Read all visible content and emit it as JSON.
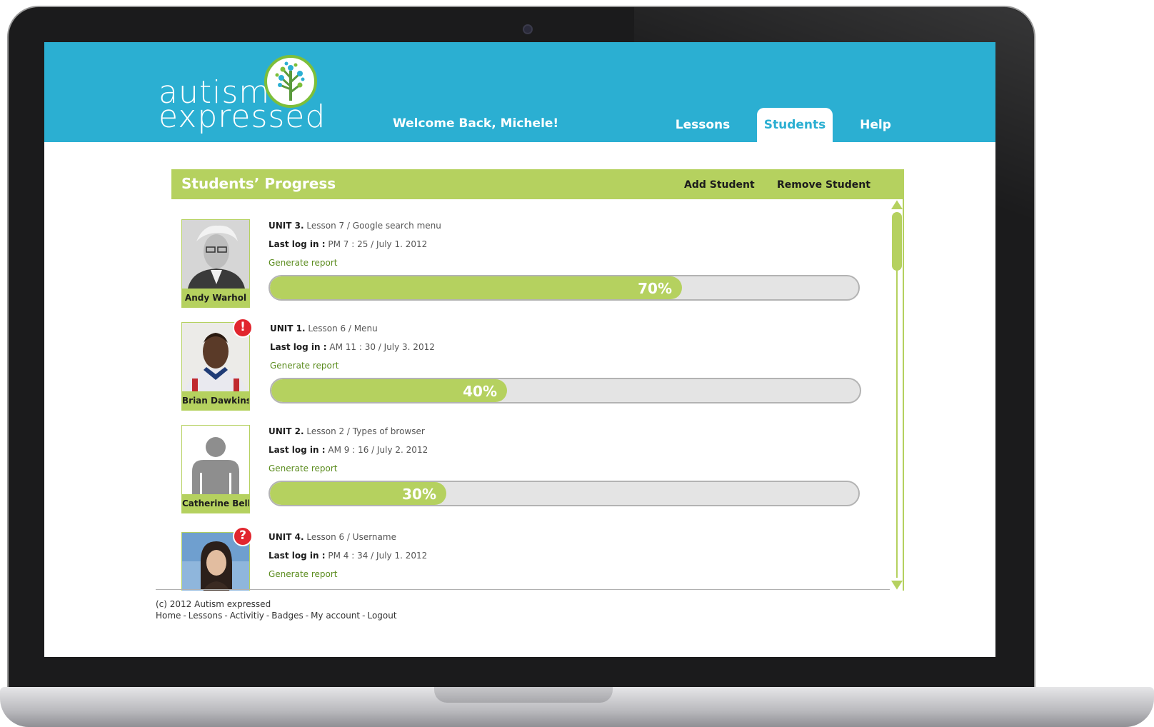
{
  "header": {
    "logo_line1": "autism",
    "logo_line2": "expressed",
    "welcome": "Welcome Back, Michele!",
    "tabs": [
      {
        "label": "Lessons",
        "active": false
      },
      {
        "label": "Students",
        "active": true
      },
      {
        "label": "Help",
        "active": false
      }
    ]
  },
  "panel": {
    "title": "Students’ Progress",
    "add_label": "Add Student",
    "remove_label": "Remove Student"
  },
  "students": [
    {
      "name": "Andy Warhol",
      "unit": "UNIT 3.",
      "lesson": "Lesson 7 / Google search menu",
      "login_label": "Last log in :",
      "login_value": "PM  7 : 25  / July 1. 2012",
      "report": "Generate report",
      "progress": 70,
      "progress_label": "70%",
      "badge": ""
    },
    {
      "name": "Brian Dawkins",
      "unit": "UNIT 1.",
      "lesson": "Lesson 6 / Menu",
      "login_label": "Last log in :",
      "login_value": "AM 11 : 30  / July 3. 2012",
      "report": "Generate report",
      "progress": 40,
      "progress_label": "40%",
      "badge": "!"
    },
    {
      "name": "Catherine Bell",
      "unit": "UNIT 2.",
      "lesson": "Lesson 2 / Types of browser",
      "login_label": "Last log in :",
      "login_value": "AM 9 : 16  / July 2. 2012",
      "report": "Generate report",
      "progress": 30,
      "progress_label": "30%",
      "badge": ""
    },
    {
      "name": "",
      "unit": "UNIT 4.",
      "lesson": "Lesson 6 / Username",
      "login_label": "Last log in :",
      "login_value": "PM 4 : 34  / July 1. 2012",
      "report": "Generate report",
      "progress": null,
      "progress_label": "",
      "badge": "?"
    }
  ],
  "footer": {
    "copyright": "(c) 2012 Autism expressed",
    "links": [
      "Home",
      "Lessons",
      "Activitiy",
      "Badges",
      "My account",
      "Logout"
    ]
  },
  "colors": {
    "header_blue": "#2bafd2",
    "accent_green": "#b5d15f",
    "alert_red": "#e1262e",
    "link_green": "#5b8c1e"
  }
}
